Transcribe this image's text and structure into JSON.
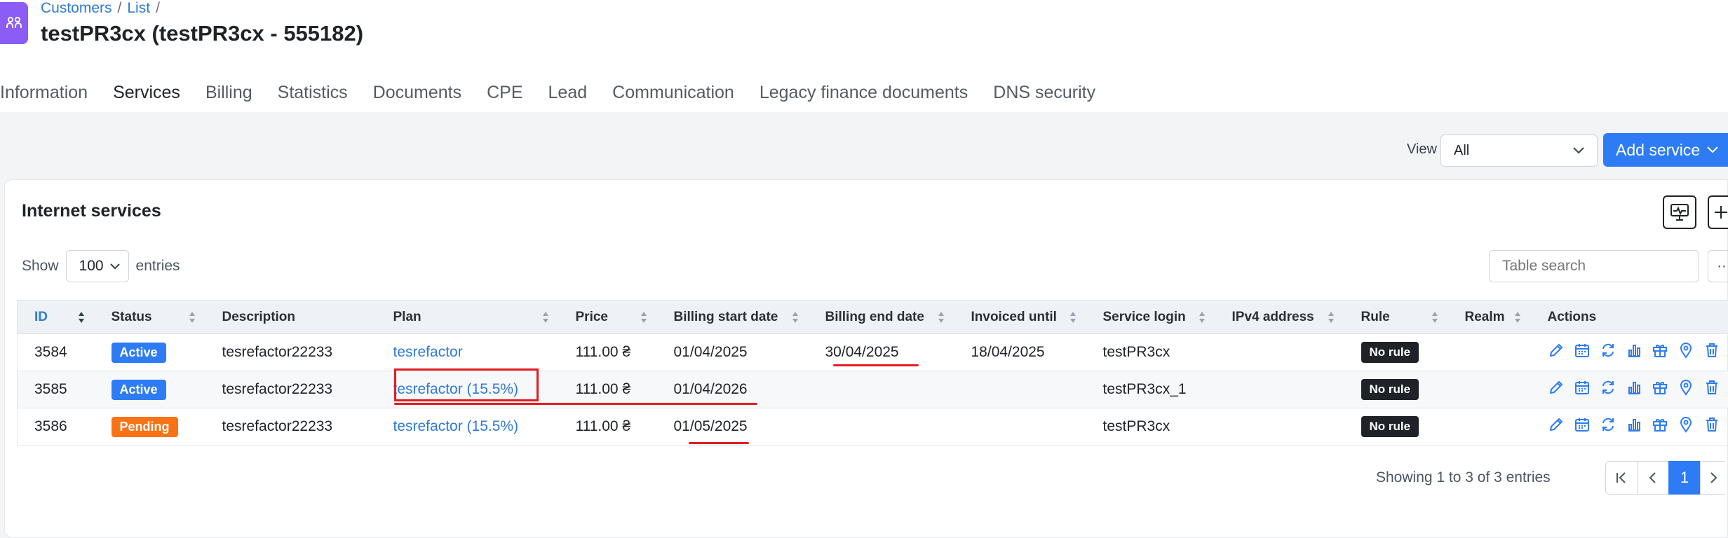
{
  "breadcrumb": {
    "customers": "Customers",
    "list": "List",
    "sep": "/"
  },
  "page_title": "testPR3cx (testPR3cx - 555182)",
  "tabs": [
    "Information",
    "Services",
    "Billing",
    "Statistics",
    "Documents",
    "CPE",
    "Lead",
    "Communication",
    "Legacy finance documents",
    "DNS security"
  ],
  "active_tab": "Services",
  "toolbar": {
    "view_label": "View",
    "view_value": "All",
    "add_service": "Add service"
  },
  "card": {
    "title": "Internet services",
    "show_label": "Show",
    "entries_value": "100",
    "entries_label": "entries",
    "search_placeholder": "Table search",
    "more_label": "··"
  },
  "table": {
    "headers": [
      "ID",
      "Status",
      "Description",
      "Plan",
      "Price",
      "Billing start date",
      "Billing end date",
      "Invoiced until",
      "Service login",
      "IPv4 address",
      "Rule",
      "Realm",
      "Actions"
    ],
    "rows": [
      {
        "id": "3584",
        "status": "Active",
        "description": "tesrefactor22233",
        "plan": "tesrefactor",
        "price": "111.00 ₴",
        "start": "01/04/2025",
        "end": "30/04/2025",
        "invoiced": "18/04/2025",
        "login": "testPR3cx",
        "ipv4": "",
        "rule": "No rule",
        "realm": ""
      },
      {
        "id": "3585",
        "status": "Active",
        "description": "tesrefactor22233",
        "plan": "tesrefactor (15.5%)",
        "price": "111.00 ₴",
        "start": "01/04/2026",
        "end": "",
        "invoiced": "",
        "login": "testPR3cx_1",
        "ipv4": "",
        "rule": "No rule",
        "realm": ""
      },
      {
        "id": "3586",
        "status": "Pending",
        "description": "tesrefactor22233",
        "plan": "tesrefactor (15.5%)",
        "price": "111.00 ₴",
        "start": "01/05/2025",
        "end": "",
        "invoiced": "",
        "login": "testPR3cx",
        "ipv4": "",
        "rule": "No rule",
        "realm": ""
      }
    ],
    "action_icons": [
      "edit-icon",
      "calendar-icon",
      "change-icon",
      "statistics-icon",
      "gift-icon",
      "location-icon",
      "delete-icon"
    ]
  },
  "footer": {
    "showing": "Showing 1 to 3 of 3 entries",
    "current_page": "1"
  },
  "colors": {
    "accent": "#2d7cf6",
    "pending": "#f97316",
    "annotation": "#e11d22",
    "app_icon": "#8b5cf6"
  }
}
